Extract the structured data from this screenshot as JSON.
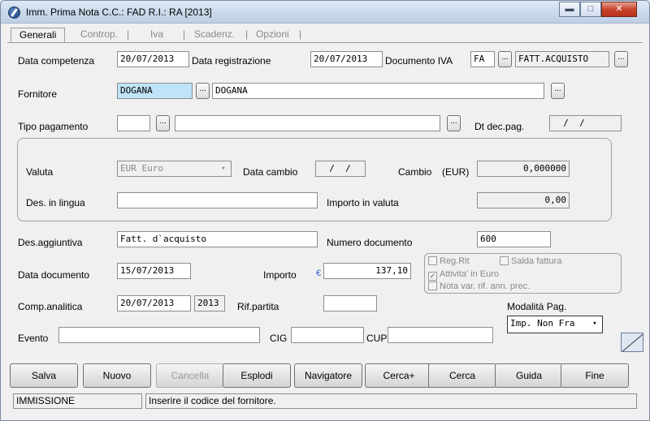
{
  "window": {
    "title": "Imm. Prima Nota C.C.: FAD  R.I.: RA  [2013]",
    "minimize_glyph": "▬",
    "maximize_glyph": "□",
    "close_glyph": "✕"
  },
  "tabs": [
    {
      "label": "Generali"
    },
    {
      "label": "Controp."
    },
    {
      "label": "Iva"
    },
    {
      "label": "Scadenz."
    },
    {
      "label": "Opzioni"
    }
  ],
  "tab_separator": "|",
  "form": {
    "data_competenza": {
      "label": "Data competenza",
      "value": "20/07/2013"
    },
    "data_registrazione": {
      "label": "Data registrazione",
      "value": "20/07/2013"
    },
    "documento_iva": {
      "label": "Documento IVA",
      "code": "FA",
      "desc": "FATT.ACQUISTO"
    },
    "fornitore": {
      "label": "Fornitore",
      "code": "DOGANA",
      "desc": "DOGANA"
    },
    "tipo_pagamento": {
      "label": "Tipo pagamento",
      "code": "",
      "desc": ""
    },
    "dt_dec_pag": {
      "label": "Dt dec.pag.",
      "value": "  /  /"
    },
    "valuta": {
      "label": "Valuta",
      "value": "EUR Euro"
    },
    "data_cambio": {
      "label": "Data cambio",
      "value": "  /  /"
    },
    "cambio": {
      "label": "Cambio",
      "unit": "(EUR)",
      "value": "0,000000"
    },
    "des_lingua": {
      "label": "Des. in lingua",
      "value": ""
    },
    "importo_valuta": {
      "label": "Importo in valuta",
      "value": "0,00"
    },
    "des_aggiuntiva": {
      "label": "Des.aggiuntiva",
      "value": "Fatt. d`acquisto"
    },
    "numero_documento": {
      "label": "Numero documento",
      "value": "600"
    },
    "data_documento": {
      "label": "Data documento",
      "value": "15/07/2013"
    },
    "importo": {
      "label": "Importo",
      "currency": "€",
      "value": "137,10"
    },
    "comp_analitica": {
      "label": "Comp.analitica",
      "value": "20/07/2013",
      "year": "2013"
    },
    "rif_partita": {
      "label": "Rif.partita",
      "value": ""
    },
    "modalita_pag": {
      "label": "Modalità Pag.",
      "value": "Imp. Non Fra"
    },
    "evento": {
      "label": "Evento",
      "value": ""
    },
    "cig": {
      "label": "CIG",
      "value": ""
    },
    "cup": {
      "label": "CUP",
      "value": ""
    }
  },
  "checkboxes": [
    {
      "label": "Reg.Rit",
      "checked": false,
      "mark": ""
    },
    {
      "label": "Salda fattura",
      "checked": false,
      "mark": ""
    },
    {
      "label": "Attivita' in Euro",
      "checked": true,
      "mark": "✓"
    },
    {
      "label": "Nota var. rif. ann. prec.",
      "checked": false,
      "mark": ""
    }
  ],
  "buttons": {
    "salva": "Salva",
    "nuovo": "Nuovo",
    "cancella": "Cancella",
    "esplodi": "Esplodi",
    "navigatore": "Navigatore",
    "cerca_plus": "Cerca+",
    "cerca": "Cerca",
    "guida": "Guida",
    "fine": "Fine"
  },
  "lookup_glyph": "...",
  "dropdown_glyph": "▾",
  "status": {
    "mode": "IMMISSIONE",
    "message": "Inserire il codice del fornitore."
  },
  "colors": {
    "highlight_field": "#bfe3f7",
    "euro_symbol": "#2a5bd0"
  }
}
